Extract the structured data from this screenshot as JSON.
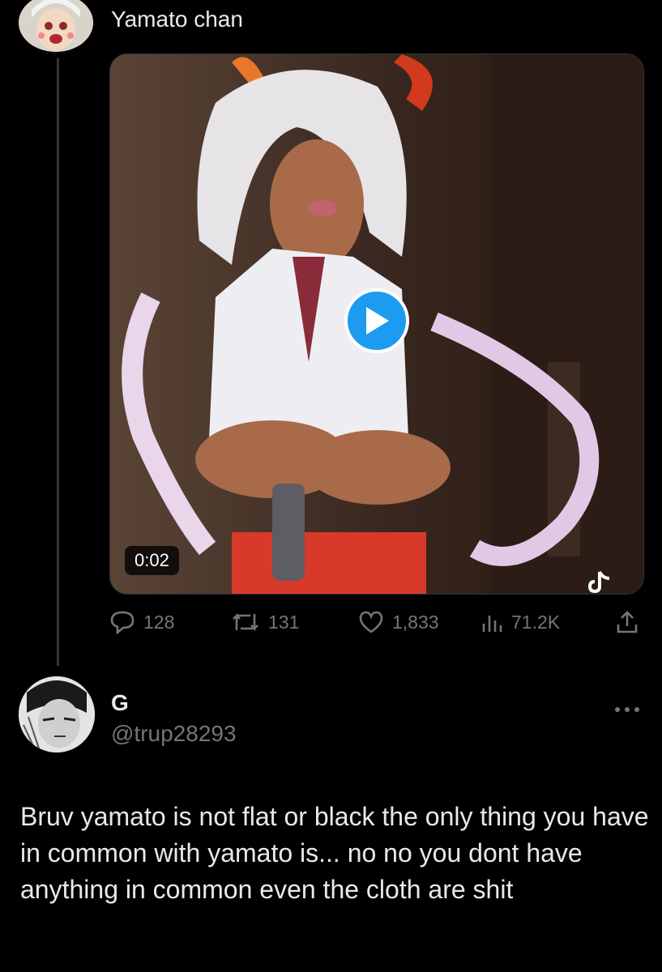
{
  "quoted_tweet": {
    "author_name": "Yamato chan",
    "video": {
      "duration": "0:02"
    },
    "stats": {
      "replies": "128",
      "retweets": "131",
      "likes": "1,833",
      "views": "71.2K"
    }
  },
  "reply": {
    "author_name": "G",
    "author_handle": "@trup28293",
    "text": "Bruv yamato is not flat or black the only thing you have in common with yamato is... no no you dont have anything in common even the cloth are shit"
  },
  "icons": [
    "reply-icon",
    "retweet-icon",
    "like-icon",
    "views-icon",
    "share-icon",
    "more-icon",
    "play-icon",
    "tiktok-icon"
  ],
  "colors": {
    "background": "#000000",
    "text": "#e7e9ea",
    "muted": "#71767b",
    "accent": "#1d9bf0"
  }
}
